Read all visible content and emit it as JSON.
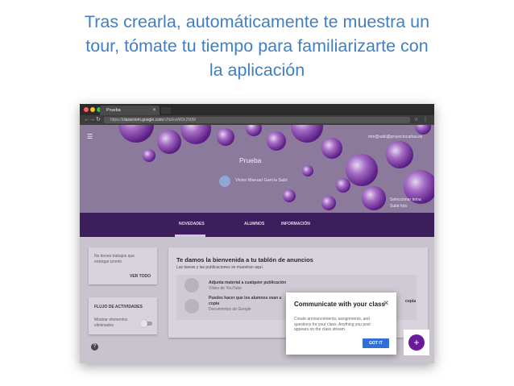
{
  "caption": {
    "line1": "Tras crearla, automáticamente te  muestra un",
    "line2": "tour, tómate tu tiempo  para familiarizarte con",
    "line3": "la aplicación"
  },
  "browser": {
    "tab_title": "Prueba",
    "url_scheme": "https://",
    "url_host": "classroom.google.com",
    "url_path": "/c/NzEwMDk2MjM",
    "colors": {
      "close": "#ff5f57",
      "minimize": "#febc2e",
      "zoom": "#28c840"
    }
  },
  "hero": {
    "class_title": "Prueba",
    "teacher_name": "Víctor Manuel García Sabí",
    "user_email": "mm@sabi@proyectocartaa.es",
    "theme_line1": "Seleccionar tema",
    "theme_line2": "Subir foto"
  },
  "nav": {
    "tabs": [
      "NOVEDADES",
      "ALUMNOS",
      "INFORMACIÓN"
    ],
    "active_tab": "NOVEDADES"
  },
  "sidebar": {
    "pending_text1": "No tienes trabajos que",
    "pending_text2": "entregar pronto",
    "view_all": "VER TODO",
    "activity_title": "FLUJO DE ACTIVIDADES",
    "activity_text1": "Mostrar elementos",
    "activity_text2": "eliminados"
  },
  "main": {
    "welcome_title": "Te damos la bienvenida a tu tablón de anuncios",
    "welcome_sub": "Las tareas y las publicaciones se muestran aquí.",
    "row1_title": "Adjunta material a cualquier publicación",
    "row1_sub": "Vídeo de YouTube",
    "row2_title_a": "Puedes hacer que los alumnos vean u",
    "row2_title_b": "copia",
    "row2_title_c": "copia",
    "row2_sub": "Documentos de Google"
  },
  "popup": {
    "title": "Communicate with your class",
    "body": "Create announcements, assignments, and questions for your class. Anything you post appears on the class stream.",
    "button": "GOT IT",
    "close_icon": "close-icon"
  },
  "fab_label": "+",
  "help_label": "?"
}
